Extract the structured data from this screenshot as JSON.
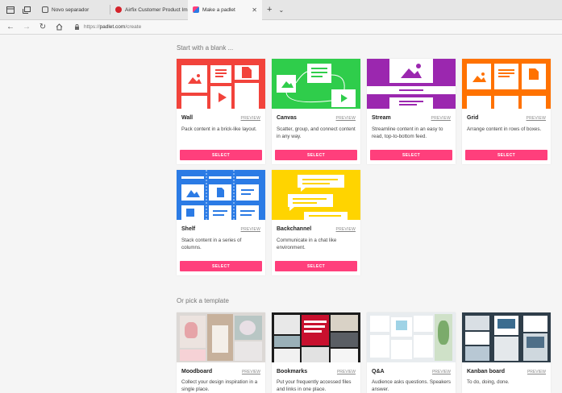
{
  "browser": {
    "tabs": [
      {
        "label": "Novo separador",
        "active": false
      },
      {
        "label": "Airfix Customer Product Im",
        "active": false
      },
      {
        "label": "Make a padlet",
        "active": true
      }
    ],
    "url_scheme": "https://",
    "url_host": "padlet.com",
    "url_path": "/create"
  },
  "blank_section": {
    "title": "Start with a blank ...",
    "cards": [
      {
        "name": "Wall",
        "preview": "PREVIEW",
        "desc": "Pack content in a brick-like layout.",
        "button": "SELECT",
        "color": "#f2433b"
      },
      {
        "name": "Canvas",
        "preview": "PREVIEW",
        "desc": "Scatter, group, and connect content in any way.",
        "button": "SELECT",
        "color": "#2fcd4b"
      },
      {
        "name": "Stream",
        "preview": "PREVIEW",
        "desc": "Streamline content in an easy to read, top-to-bottom feed.",
        "button": "SELECT",
        "color": "#9b27af"
      },
      {
        "name": "Grid",
        "preview": "PREVIEW",
        "desc": "Arrange content in rows of boxes.",
        "button": "SELECT",
        "color": "#ff7200"
      },
      {
        "name": "Shelf",
        "preview": "PREVIEW",
        "desc": "Stack content in a series of columns.",
        "button": "SELECT",
        "color": "#2b7be5"
      },
      {
        "name": "Backchannel",
        "preview": "PREVIEW",
        "desc": "Communicate in a chat like environment.",
        "button": "SELECT",
        "color": "#ffd400"
      }
    ]
  },
  "template_section": {
    "title": "Or pick a template",
    "cards": [
      {
        "name": "Moodboard",
        "preview": "PREVIEW",
        "desc": "Collect your design inspiration in a single place."
      },
      {
        "name": "Bookmarks",
        "preview": "PREVIEW",
        "desc": "Put your frequently accessed files and links in one place."
      },
      {
        "name": "Q&A",
        "preview": "PREVIEW",
        "desc": "Audience asks questions. Speakers answer."
      },
      {
        "name": "Kanban board",
        "preview": "PREVIEW",
        "desc": "To do, doing, done."
      }
    ]
  },
  "colors": {
    "accent": "#ff3f7c"
  }
}
